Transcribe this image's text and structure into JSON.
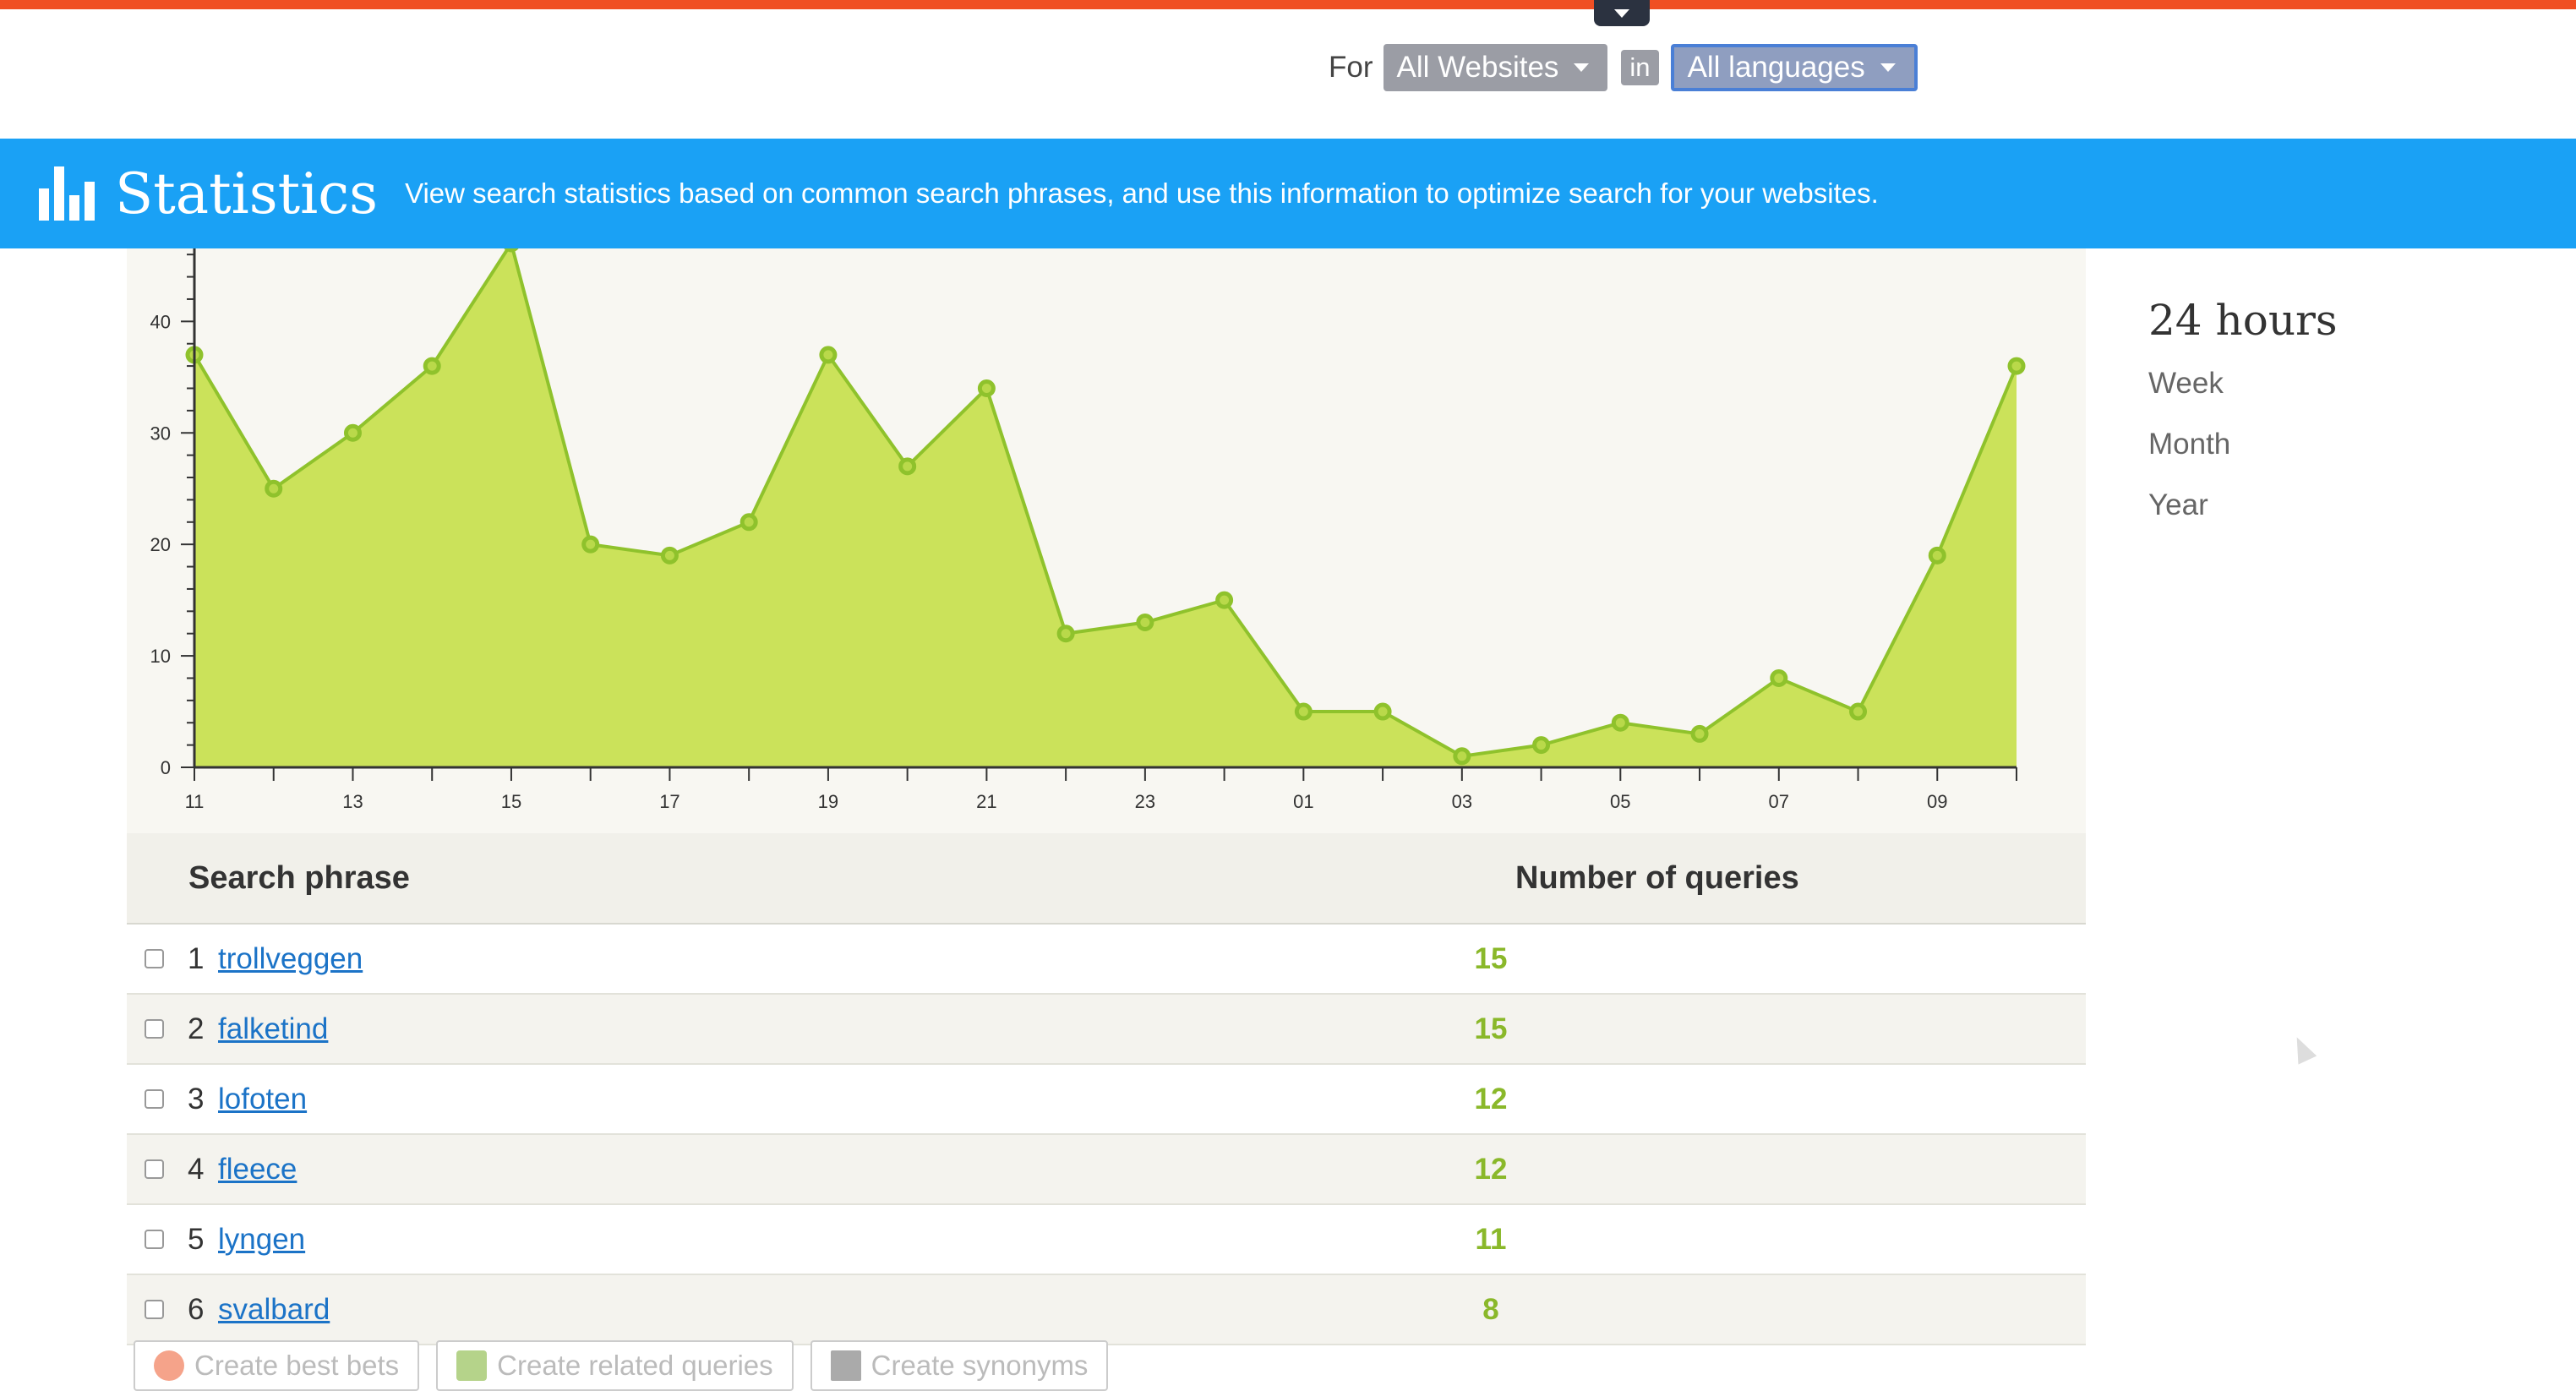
{
  "filters": {
    "for_label": "For",
    "websites_value": "All Websites",
    "in_label": "in",
    "languages_value": "All languages"
  },
  "banner": {
    "title": "Statistics",
    "description": "View search statistics based on common search phrases, and use this information to optimize search for your websites."
  },
  "time_ranges": {
    "active": "24 hours",
    "options": [
      "Week",
      "Month",
      "Year"
    ]
  },
  "chart_data": {
    "type": "area",
    "x_tick_labels": [
      "11",
      "13",
      "15",
      "17",
      "19",
      "21",
      "23",
      "01",
      "03",
      "05",
      "07",
      "09"
    ],
    "y_tick_labels": [
      "0",
      "10",
      "20",
      "30",
      "40"
    ],
    "ylim": [
      0,
      47
    ],
    "grid": false,
    "colors": {
      "fill": "#cbe25a",
      "line": "#8fc22c",
      "marker": "#8fc22c"
    },
    "x": [
      "11",
      "12",
      "13",
      "14",
      "15",
      "16",
      "17",
      "18",
      "19",
      "20",
      "21",
      "22",
      "23",
      "00",
      "01",
      "02",
      "03",
      "04",
      "05",
      "06",
      "07",
      "08",
      "09",
      "10"
    ],
    "values": [
      37,
      25,
      30,
      36,
      47,
      20,
      19,
      22,
      37,
      27,
      34,
      12,
      13,
      15,
      5,
      5,
      1,
      2,
      4,
      3,
      8,
      5,
      19,
      36
    ]
  },
  "table": {
    "headers": {
      "phrase": "Search phrase",
      "count": "Number of queries"
    },
    "rows": [
      {
        "rank": "1",
        "phrase": "trollveggen",
        "count": "15"
      },
      {
        "rank": "2",
        "phrase": "falketind",
        "count": "15"
      },
      {
        "rank": "3",
        "phrase": "lofoten",
        "count": "12"
      },
      {
        "rank": "4",
        "phrase": "fleece",
        "count": "12"
      },
      {
        "rank": "5",
        "phrase": "lyngen",
        "count": "11"
      },
      {
        "rank": "6",
        "phrase": "svalbard",
        "count": "8"
      }
    ]
  },
  "actions": {
    "best_bets": "Create best bets",
    "related_queries": "Create related queries",
    "synonyms": "Create synonyms"
  }
}
